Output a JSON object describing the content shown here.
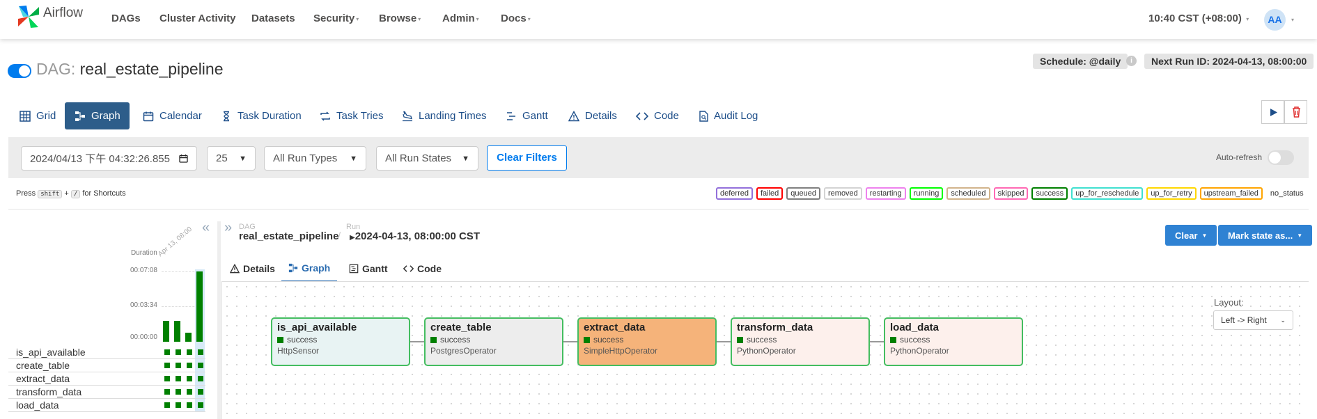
{
  "nav": {
    "brand": "Airflow",
    "items": [
      "DAGs",
      "Cluster Activity",
      "Datasets",
      "Security",
      "Browse",
      "Admin",
      "Docs"
    ],
    "time": "10:40 CST (+08:00)",
    "user_initials": "AA"
  },
  "header": {
    "prefix": "DAG:",
    "dag_id": "real_estate_pipeline",
    "schedule": "Schedule: @daily",
    "next_run": "Next Run ID: 2024-04-13, 08:00:00",
    "paused": false
  },
  "views": [
    "Grid",
    "Graph",
    "Calendar",
    "Task Duration",
    "Task Tries",
    "Landing Times",
    "Gantt",
    "Details",
    "Code",
    "Audit Log"
  ],
  "active_view": "Graph",
  "filters": {
    "base_date": "2024/04/13 下午 04:32:26.855",
    "num_runs": "25",
    "run_type": "All Run Types",
    "run_state": "All Run States",
    "clear_label": "Clear Filters",
    "auto_refresh_label": "Auto-refresh"
  },
  "shortcuts": {
    "press": "Press",
    "key1": "shift",
    "plus": "+",
    "key2": "/",
    "suffix": "for Shortcuts"
  },
  "legend": [
    {
      "label": "deferred",
      "color": "#9370db"
    },
    {
      "label": "failed",
      "color": "#ff0000"
    },
    {
      "label": "queued",
      "color": "#808080"
    },
    {
      "label": "removed",
      "color": "#d3d3d3"
    },
    {
      "label": "restarting",
      "color": "#ee82ee"
    },
    {
      "label": "running",
      "color": "#00ff00"
    },
    {
      "label": "scheduled",
      "color": "#d2b48c"
    },
    {
      "label": "skipped",
      "color": "#ff69b4"
    },
    {
      "label": "success",
      "color": "#008000"
    },
    {
      "label": "up_for_reschedule",
      "color": "#40e0d0"
    },
    {
      "label": "up_for_retry",
      "color": "#ffd700"
    },
    {
      "label": "upstream_failed",
      "color": "#ffa500"
    },
    {
      "label": "no_status",
      "color": ""
    }
  ],
  "grid": {
    "duration_label": "Duration",
    "date_label": "Apr 13, 08:00",
    "y_ticks": [
      "00:07:08",
      "00:03:34",
      "00:00:00"
    ],
    "tasks": [
      "is_api_available",
      "create_table",
      "extract_data",
      "transform_data",
      "load_data"
    ]
  },
  "details": {
    "dag_label": "DAG",
    "dag_id": "real_estate_pipeline",
    "run_label": "Run",
    "run_id": "2024-04-13, 08:00:00 CST",
    "clear_btn": "Clear",
    "mark_btn": "Mark state as...",
    "tabs": [
      "Details",
      "Graph",
      "Gantt",
      "Code"
    ],
    "active_tab": "Graph"
  },
  "graph": {
    "layout_label": "Layout:",
    "layout_value": "Left -> Right",
    "nodes": [
      {
        "name": "is_api_available",
        "status": "success",
        "operator": "HttpSensor",
        "bg": "#e8f3f3"
      },
      {
        "name": "create_table",
        "status": "success",
        "operator": "PostgresOperator",
        "bg": "#ededed"
      },
      {
        "name": "extract_data",
        "status": "success",
        "operator": "SimpleHttpOperator",
        "bg": "#f5b37a"
      },
      {
        "name": "transform_data",
        "status": "success",
        "operator": "PythonOperator",
        "bg": "#fdf0ec"
      },
      {
        "name": "load_data",
        "status": "success",
        "operator": "PythonOperator",
        "bg": "#fdf0ec"
      }
    ]
  }
}
